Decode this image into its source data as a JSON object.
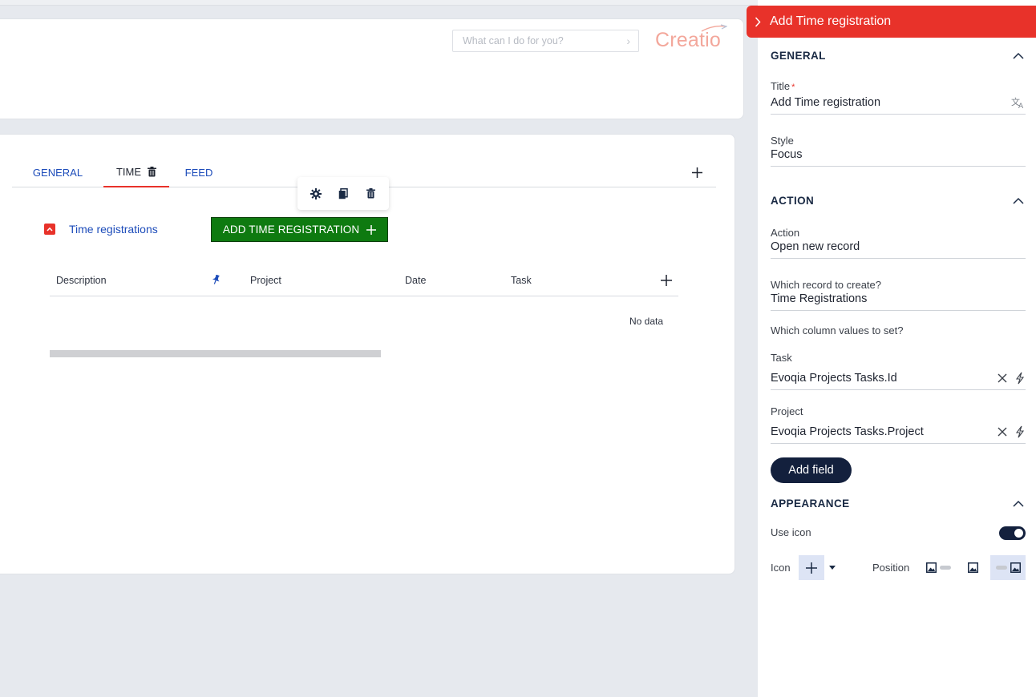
{
  "header": {
    "search_placeholder": "What can I do for you?",
    "logo_text": "Creatio"
  },
  "tabs": [
    {
      "label": "GENERAL"
    },
    {
      "label": "TIME"
    },
    {
      "label": "FEED"
    }
  ],
  "detail": {
    "title": "Time registrations",
    "add_button_label": "ADD TIME REGISTRATION",
    "columns": [
      "Description",
      "Project",
      "Date",
      "Task"
    ],
    "empty_text": "No data"
  },
  "panel": {
    "title": "Add Time registration",
    "general": {
      "section_title": "GENERAL",
      "title_label": "Title",
      "title_required_mark": "*",
      "title_value": "Add Time registration",
      "style_label": "Style",
      "style_value": "Focus"
    },
    "action": {
      "section_title": "ACTION",
      "action_label": "Action",
      "action_value": "Open new record",
      "record_label": "Which record to create?",
      "record_value": "Time Registrations",
      "column_values_label": "Which column values to set?",
      "task_label": "Task",
      "task_value": "Evoqia Projects Tasks.Id",
      "project_label": "Project",
      "project_value": "Evoqia Projects Tasks.Project",
      "add_field_label": "Add field"
    },
    "appearance": {
      "section_title": "APPEARANCE",
      "use_icon_label": "Use icon",
      "use_icon_on": true,
      "icon_label": "Icon",
      "position_label": "Position"
    }
  },
  "colors": {
    "accent_red": "#e8322a",
    "button_green": "#0e7a10",
    "link_blue": "#1d4cba",
    "navy": "#13203d"
  }
}
